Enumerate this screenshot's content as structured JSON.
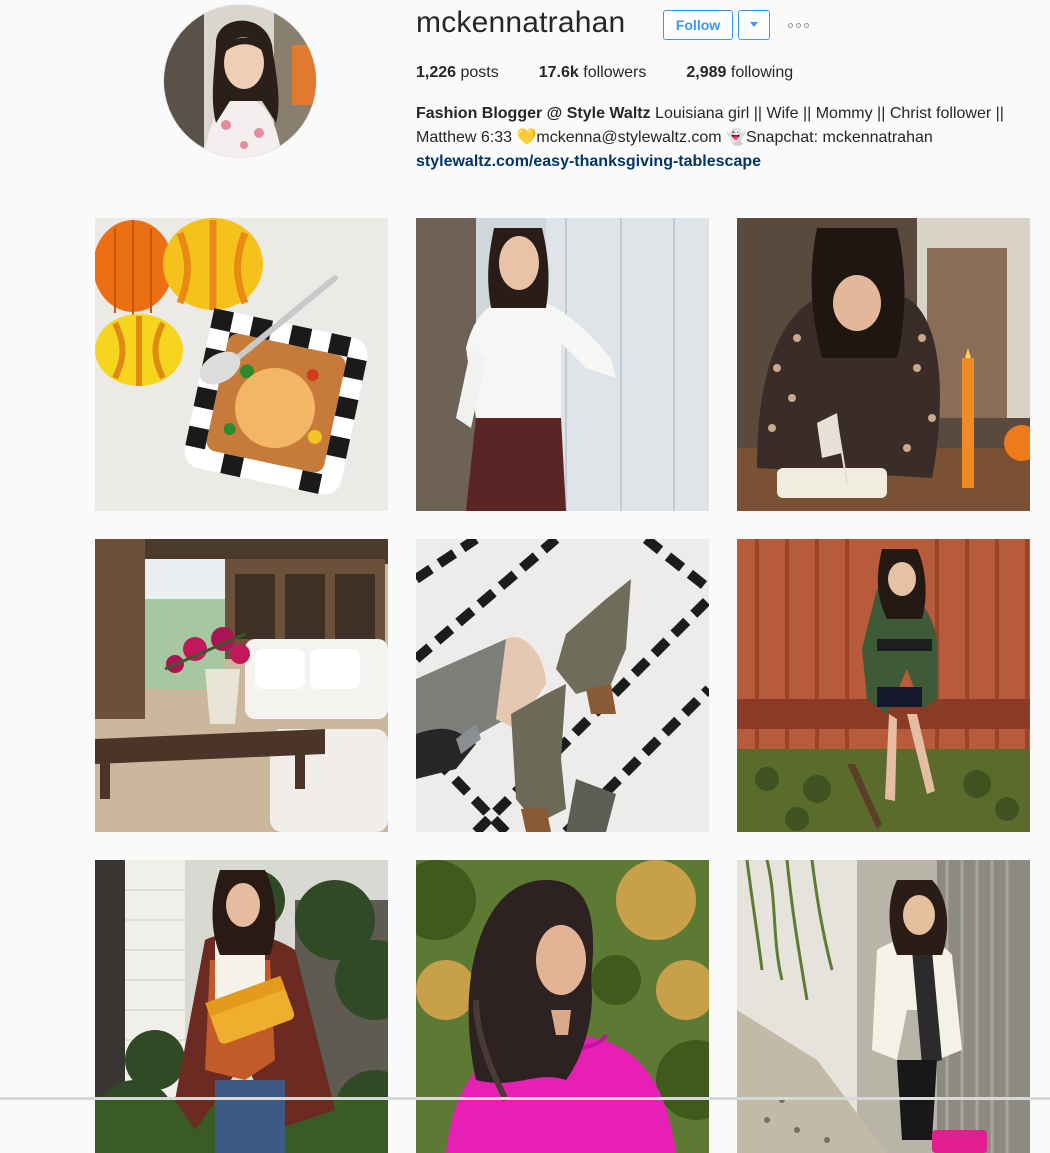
{
  "profile": {
    "username": "mckennatrahan",
    "follow_label": "Follow",
    "dropdown_icon": "chevron-down-icon",
    "more_icon": "ellipsis-icon",
    "stats": {
      "posts_count": "1,226",
      "posts_label": "posts",
      "followers_count": "17.6k",
      "followers_label": "followers",
      "following_count": "2,989",
      "following_label": "following"
    },
    "bio": {
      "name": "Fashion Blogger @ Style Waltz",
      "line1": " Louisiana girl || Wife || Mommy || Christ follower || Matthew 6:33 ",
      "heart": "💛",
      "email": "mckenna@stylewaltz.com ",
      "ghost": "👻",
      "snapchat": "Snapchat: mckennatrahan",
      "link": "stylewaltz.com/easy-thanksgiving-tablescape"
    }
  },
  "posts": [
    {
      "subject": "pumpkins-and-pot-pie"
    },
    {
      "subject": "white-shirt-leather-skirt"
    },
    {
      "subject": "table-setting-candle"
    },
    {
      "subject": "patio-living-room"
    },
    {
      "subject": "suede-ankle-boots"
    },
    {
      "subject": "green-dress-red-wall"
    },
    {
      "subject": "poncho-yellow-clutch"
    },
    {
      "subject": "pink-sweater-portrait"
    },
    {
      "subject": "white-sweater-scarf"
    }
  ],
  "colors": {
    "accent": "#3897f0",
    "link": "#003569",
    "text": "#262626",
    "background": "#fafafa"
  }
}
